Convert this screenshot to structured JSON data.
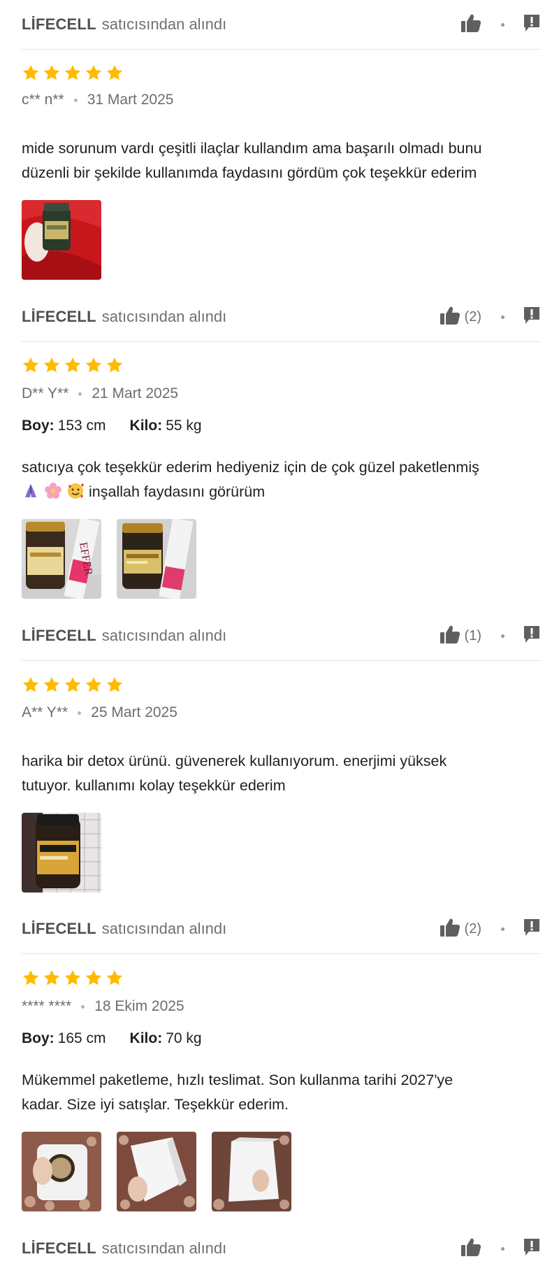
{
  "reviews_section": {
    "seller_label": {
      "name": "LİFECELL",
      "suffix": "satıcısından alındı"
    },
    "theme": {
      "star_color": "#FFBB00",
      "text_color": "#1f1f1f",
      "muted_color": "#6d6d6d",
      "divider_color": "#e6e6e6"
    },
    "icons": {
      "like": "thumbs-up-icon",
      "report": "report-flag-icon",
      "rating": "star-icon"
    },
    "top_seller_row": {
      "like_count": ""
    },
    "reviews": [
      {
        "rating": 5,
        "author": "c** n**",
        "date": "31 Mart 2025",
        "text_lines": [
          "mide sorunum vardı çeşitli ilaçlar kullandım ama başarılı olmadı bunu",
          "düzenli bir şekilde kullanımda faydasını gördüm çok teşekkür ederim"
        ],
        "photos": [
          "supplement-bottle-on-red-fabric"
        ],
        "like_count": "(2)"
      },
      {
        "rating": 5,
        "author": "D** Y**",
        "date": "21 Mart 2025",
        "height": {
          "label": "Boy:",
          "value": "153 cm"
        },
        "weight": {
          "label": "Kilo:",
          "value": "55 kg"
        },
        "text_lines": [
          "satıcıya çok teşekkür ederim hediyeniz için de çok güzel paketlenmiş",
          "inşallah faydasını görürüm"
        ],
        "emojis": [
          "folded-hands-emoji",
          "flower-emoji",
          "smiling-face-with-hearts-emoji"
        ],
        "photos": [
          "liver-detox-bottle-and-effer-slim-tube-1",
          "liver-detox-bottle-and-effer-slim-tube-2"
        ],
        "like_count": "(1)"
      },
      {
        "rating": 5,
        "author": "A** Y**",
        "date": "25 Mart 2025",
        "text_lines": [
          "harika bir detox ürünü. güvenerek kullanıyorum. enerjimi yüksek",
          "tutuyor. kullanımı kolay teşekkür ederim"
        ],
        "photos": [
          "liver-detox-bottle-on-lace"
        ],
        "like_count": "(2)"
      },
      {
        "rating": 5,
        "author": "**** ****",
        "date": "18 Ekim 2025",
        "height": {
          "label": "Boy:",
          "value": "165 cm"
        },
        "weight": {
          "label": "Kilo:",
          "value": "70 kg"
        },
        "text_lines": [
          "Mükemmel paketleme, hızlı teslimat. Son kullanma tarihi 2027'ye",
          "kadar. Size iyi satışlar. Teşekkür ederim."
        ],
        "photos": [
          "foam-packaging-with-bottle",
          "foam-packaging-block-1",
          "foam-packaging-block-2"
        ],
        "like_count": ""
      }
    ]
  }
}
